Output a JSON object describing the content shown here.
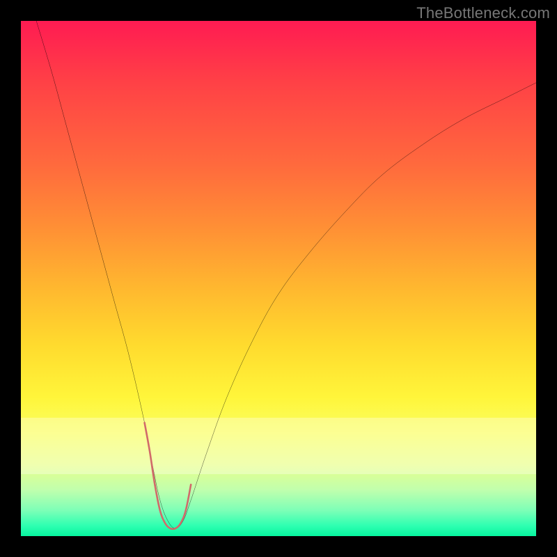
{
  "watermark": "TheBottleneck.com",
  "chart_data": {
    "type": "line",
    "title": "",
    "xlabel": "",
    "ylabel": "",
    "xlim": [
      0,
      100
    ],
    "ylim": [
      0,
      100
    ],
    "grid": false,
    "legend": false,
    "annotations": [],
    "series": [
      {
        "name": "bottleneck-curve",
        "color": "#000000",
        "x": [
          3,
          6,
          9,
          12,
          15,
          18,
          21,
          24,
          25.5,
          27,
          28.5,
          30,
          31.5,
          33,
          36,
          40,
          45,
          50,
          56,
          63,
          70,
          78,
          86,
          94,
          100
        ],
        "y": [
          100,
          90,
          79,
          68,
          57,
          46,
          35,
          22,
          14,
          7,
          3,
          1.5,
          3,
          7,
          16,
          27,
          38,
          47,
          55,
          63,
          70,
          76,
          81,
          85,
          88
        ]
      },
      {
        "name": "bottleneck-min-marker",
        "color": "#d16a6a",
        "style": "thick-round",
        "x": [
          24,
          25,
          26,
          27,
          28,
          29,
          30,
          31,
          32,
          33
        ],
        "y": [
          22,
          16.5,
          10,
          5,
          2.5,
          1.5,
          1.5,
          2.5,
          5,
          10
        ]
      }
    ],
    "gradient_scale": {
      "orientation": "vertical",
      "stops": [
        {
          "pos": 0.0,
          "color": "#ff1b52"
        },
        {
          "pos": 0.28,
          "color": "#ff6a3d"
        },
        {
          "pos": 0.55,
          "color": "#ffdb2e"
        },
        {
          "pos": 0.8,
          "color": "#faff61"
        },
        {
          "pos": 1.0,
          "color": "#07f59f"
        }
      ]
    }
  }
}
